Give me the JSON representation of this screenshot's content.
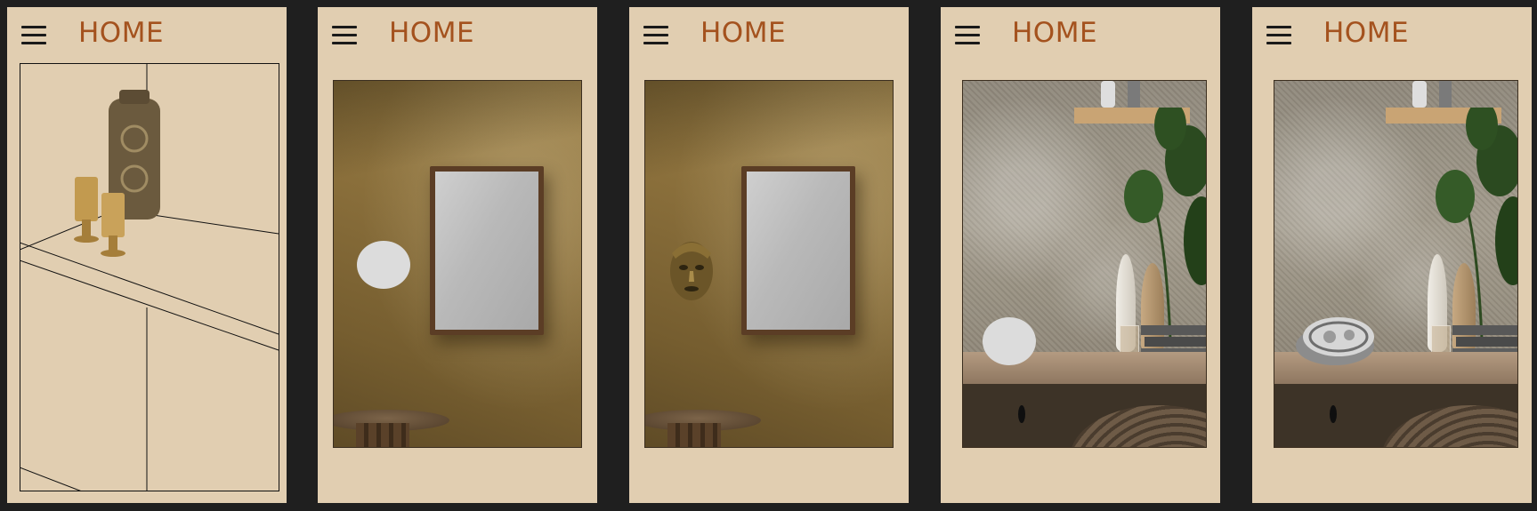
{
  "screens": [
    {
      "title": "HOME"
    },
    {
      "title": "HOME"
    },
    {
      "title": "HOME"
    },
    {
      "title": "HOME"
    },
    {
      "title": "HOME"
    }
  ],
  "icons": {
    "menu": "hamburger-menu-icon"
  },
  "colors": {
    "background": "#1f1f1f",
    "screen": "#e1ceb1",
    "title": "#a4521e"
  }
}
